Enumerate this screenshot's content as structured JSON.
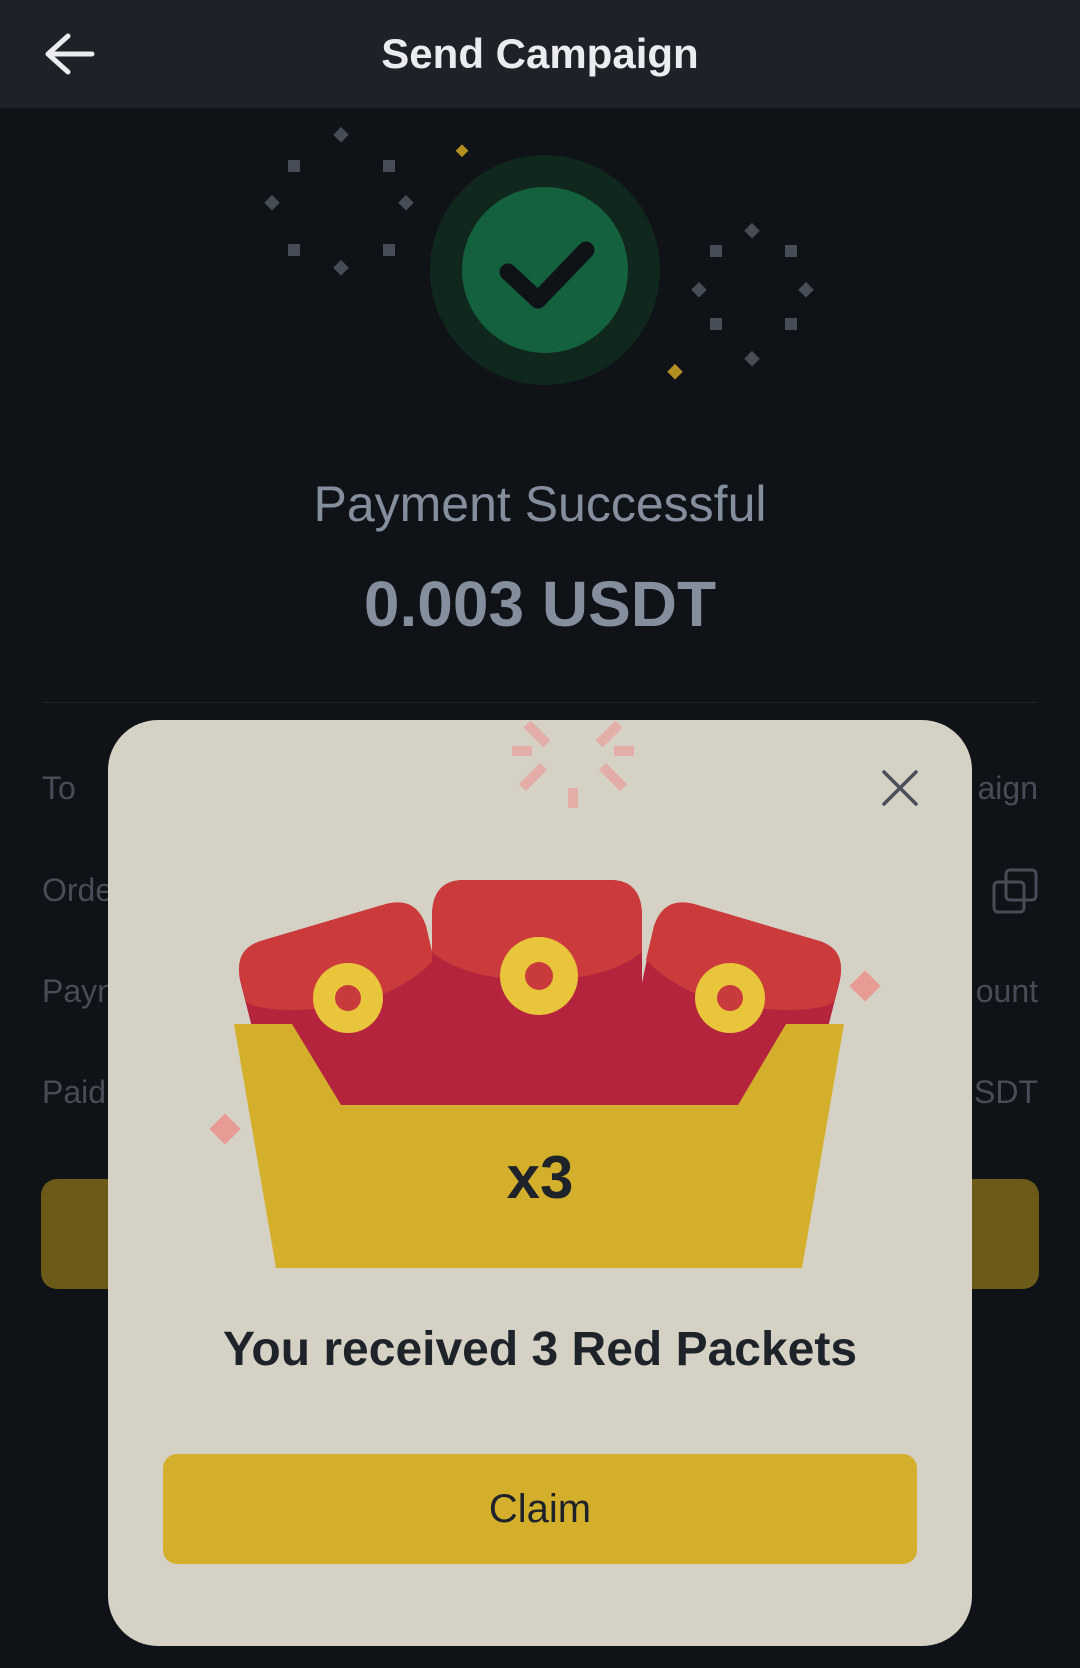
{
  "header": {
    "title": "Send Campaign",
    "back_icon": "arrow-left-icon"
  },
  "result": {
    "status": "Payment Successful",
    "amount": "0.003 USDT",
    "icon": "check-circle-icon"
  },
  "details": [
    {
      "label": "To",
      "value": "aign"
    },
    {
      "label": "Orde",
      "value": ""
    },
    {
      "label": "Payn",
      "value": "ount"
    },
    {
      "label": "Paid",
      "value": "SDT"
    }
  ],
  "modal": {
    "count_label": "x3",
    "message": "You received 3 Red Packets",
    "claim_label": "Claim",
    "close_icon": "close-icon"
  },
  "colors": {
    "background": "#0f1217",
    "header": "#1d2128",
    "success_green": "#14613e",
    "modal_background": "#d5d1c5",
    "accent_yellow": "#d4af2c",
    "packet_red": "#c93a3c"
  }
}
